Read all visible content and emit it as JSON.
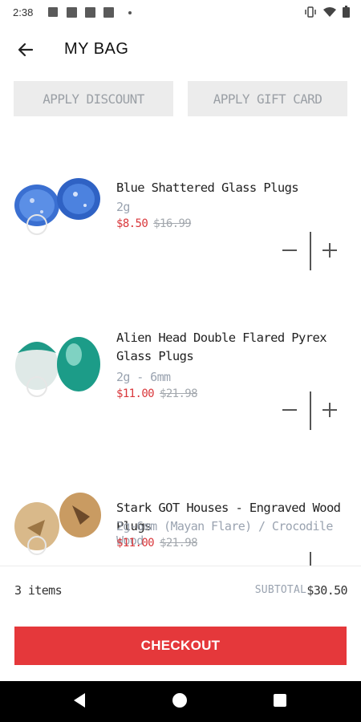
{
  "status_bar": {
    "time": "2:38"
  },
  "header": {
    "title": "MY BAG"
  },
  "actions": {
    "discount_label": "APPLY DISCOUNT",
    "gift_card_label": "APPLY GIFT CARD"
  },
  "items": [
    {
      "name": "Blue Shattered Glass Plugs",
      "variant": "2g",
      "sale_price": "$8.50",
      "original_price": "$16.99"
    },
    {
      "name": "Alien Head Double Flared Pyrex Glass Plugs",
      "variant": "2g - 6mm",
      "sale_price": "$11.00",
      "original_price": "$21.98"
    },
    {
      "name": "Stark GOT Houses - Engraved Wood Plugs",
      "variant": "2g-6mm (Mayan Flare) / Crocodile Wood",
      "sale_price": "$11.00",
      "original_price": "$21.98"
    }
  ],
  "footer": {
    "item_count": "3 items",
    "subtotal_label": "SUBTOTAL",
    "subtotal_value": "$30.50"
  },
  "checkout_label": "CHECKOUT",
  "colors": {
    "accent": "#e5383b",
    "muted_text": "#9aa3b0",
    "button_gray": "#ececec"
  },
  "icons": [
    "back-arrow-icon",
    "wifi-icon",
    "battery-icon",
    "vibrate-icon",
    "minus-icon",
    "plus-icon",
    "nav-back-icon",
    "nav-home-icon",
    "nav-recent-icon"
  ]
}
